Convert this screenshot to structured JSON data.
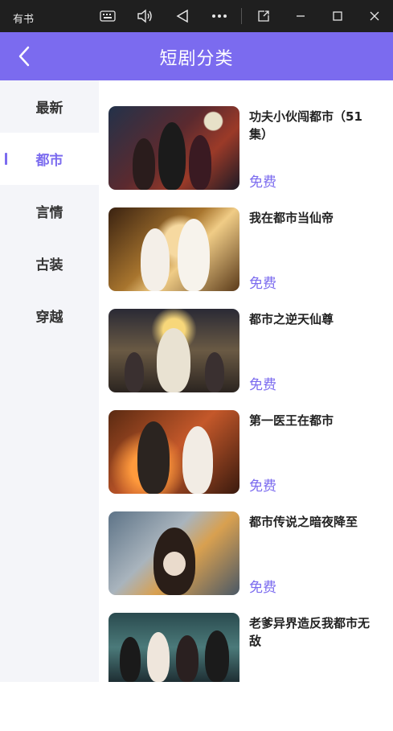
{
  "window": {
    "title": "有书",
    "buttons": [
      "keyboard-icon",
      "volume-icon",
      "back-triangle-icon",
      "more-icon",
      "external-icon",
      "minimize-icon",
      "maximize-icon",
      "close-icon"
    ]
  },
  "header": {
    "title": "短剧分类",
    "accent_color": "#7b6bef"
  },
  "sidebar": {
    "items": [
      {
        "label": "最新",
        "active": false
      },
      {
        "label": "都市",
        "active": true
      },
      {
        "label": "言情",
        "active": false
      },
      {
        "label": "古装",
        "active": false
      },
      {
        "label": "穿越",
        "active": false
      }
    ]
  },
  "dramas": [
    {
      "title": "功夫小伙闯都市（51集）",
      "tag": "免费"
    },
    {
      "title": "我在都市当仙帝",
      "tag": "免费"
    },
    {
      "title": "都市之逆天仙尊",
      "tag": "免费"
    },
    {
      "title": "第一医王在都市",
      "tag": "免费"
    },
    {
      "title": "都市传说之暗夜降至",
      "tag": "免费"
    },
    {
      "title": "老爹异界造反我都市无敌",
      "tag": ""
    }
  ]
}
